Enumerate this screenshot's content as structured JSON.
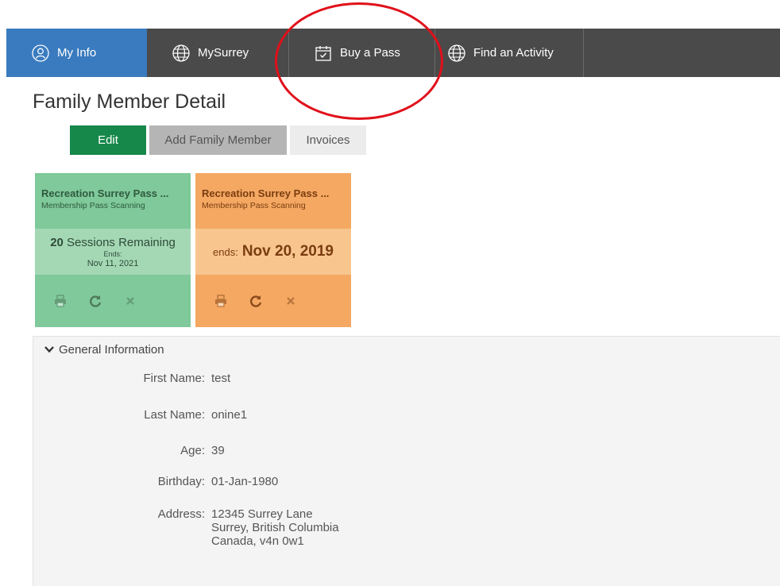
{
  "nav": {
    "items": [
      {
        "label": "My Info",
        "icon": "user-icon"
      },
      {
        "label": "MySurrey",
        "icon": "globe-icon"
      },
      {
        "label": "Buy a Pass",
        "icon": "calendar-check-icon"
      },
      {
        "label": "Find an Activity",
        "icon": "globe-icon"
      }
    ]
  },
  "page": {
    "title": "Family Member Detail"
  },
  "actions": {
    "edit": "Edit",
    "add_family": "Add Family Member",
    "invoices": "Invoices"
  },
  "passes": [
    {
      "name": "Recreation Surrey Pass ...",
      "type": "Membership Pass Scanning",
      "sessions_count": "20",
      "sessions_label": "Sessions Remaining",
      "ends_label": "Ends:",
      "ends_date": "Nov 11, 2021",
      "color": "#7fc99a"
    },
    {
      "name": "Recreation Surrey Pass ...",
      "type": "Membership Pass Scanning",
      "ends_label": "ends:",
      "ends_date": "Nov 20, 2019",
      "color": "#f4a862"
    }
  ],
  "general": {
    "heading": "General Information",
    "fields": {
      "first_name": {
        "label": "First Name:",
        "value": "test"
      },
      "last_name": {
        "label": "Last Name:",
        "value": "onine1"
      },
      "age": {
        "label": "Age:",
        "value": "39"
      },
      "birthday": {
        "label": "Birthday:",
        "value": "01-Jan-1980"
      },
      "address": {
        "label": "Address:",
        "line1": "12345 Surrey Lane",
        "line2": "Surrey, British Columbia",
        "line3": "Canada, v4n 0w1"
      }
    }
  },
  "colors": {
    "nav_bg": "#4a4a4a",
    "nav_active": "#3a7bbf",
    "edit_button": "#15884a",
    "annotation": "#e0101a"
  }
}
